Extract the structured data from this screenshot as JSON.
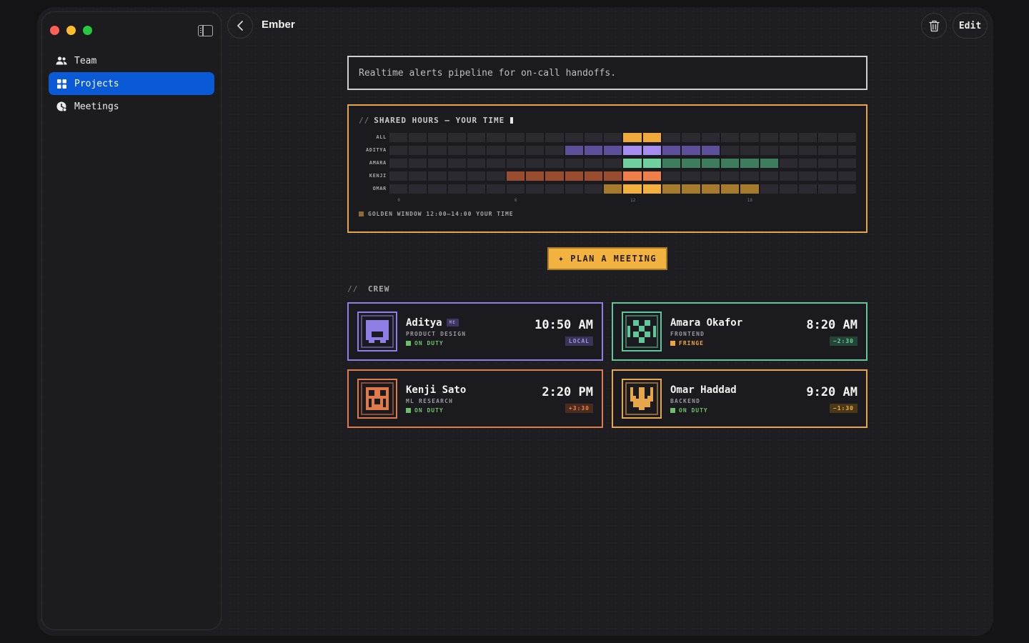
{
  "window": {
    "title": "Ember"
  },
  "sidebar": {
    "items": [
      {
        "label": "Team",
        "icon": "team-icon",
        "active": false
      },
      {
        "label": "Projects",
        "icon": "grid-icon",
        "active": true
      },
      {
        "label": "Meetings",
        "icon": "meetings-icon",
        "active": false
      }
    ]
  },
  "toolbar": {
    "edit_label": "Edit"
  },
  "project": {
    "description": "Realtime alerts pipeline for on-call handoffs."
  },
  "shared_hours": {
    "title": "SHARED HOURS — YOUR TIME",
    "slash": "//",
    "axis_labels": [
      "0",
      "6",
      "12",
      "18"
    ],
    "golden_window": "GOLDEN WINDOW 12:00–14:00 YOUR TIME",
    "rows": [
      {
        "label": "ALL",
        "color": "#f0aa3c",
        "dim": "#f0aa3c",
        "bright": [
          12,
          13
        ],
        "dim_hours": []
      },
      {
        "label": "ADITYA",
        "color": "#a48cf0",
        "dim": "#5d4f9a",
        "bright": [
          12,
          13
        ],
        "dim_hours": [
          9,
          10,
          11,
          14,
          15,
          16
        ]
      },
      {
        "label": "AMARA",
        "color": "#6fd29e",
        "dim": "#3e7d5b",
        "bright": [
          12,
          13
        ],
        "dim_hours": [
          14,
          15,
          16,
          17,
          18,
          19
        ]
      },
      {
        "label": "KENJI",
        "color": "#ee7f4b",
        "dim": "#9a4d2e",
        "bright": [
          12,
          13
        ],
        "dim_hours": [
          6,
          7,
          8,
          9,
          10,
          11
        ]
      },
      {
        "label": "OMAR",
        "color": "#f2b13e",
        "dim": "#a57a2c",
        "bright": [
          12,
          13
        ],
        "dim_hours": [
          11,
          14,
          15,
          16,
          17,
          18
        ]
      }
    ]
  },
  "plan_button": {
    "label": "PLAN A MEETING"
  },
  "crew": {
    "title": "CREW",
    "slash": "//",
    "members": [
      {
        "name": "Aditya",
        "badge": "ME",
        "role": "PRODUCT DESIGN",
        "status": "ON DUTY",
        "status_color": "#6cc06a",
        "time": "10:50 AM",
        "offset": "LOCAL",
        "accent": "#8e7ee6",
        "offset_bg": "#3a3458",
        "offset_fg": "#9d90dc",
        "avatar": "block-face-icon"
      },
      {
        "name": "Amara Okafor",
        "badge": "",
        "role": "FRONTEND",
        "status": "FRINGE",
        "status_color": "#f0a43a",
        "time": "8:20 AM",
        "offset": "−2:30",
        "accent": "#5fc79a",
        "offset_bg": "#234436",
        "offset_fg": "#6fd29e",
        "avatar": "checker-face-icon"
      },
      {
        "name": "Kenji Sato",
        "badge": "",
        "role": "ML RESEARCH",
        "status": "ON DUTY",
        "status_color": "#6cc06a",
        "time": "2:20 PM",
        "offset": "+3:30",
        "accent": "#e07a4a",
        "offset_bg": "#4a2b1e",
        "offset_fg": "#ee7f4b",
        "avatar": "grin-face-icon"
      },
      {
        "name": "Omar Haddad",
        "badge": "",
        "role": "BACKEND",
        "status": "ON DUTY",
        "status_color": "#6cc06a",
        "time": "9:20 AM",
        "offset": "−1:30",
        "accent": "#e8a64a",
        "offset_bg": "#4a3818",
        "offset_fg": "#f2b13e",
        "avatar": "crown-face-icon"
      }
    ]
  }
}
